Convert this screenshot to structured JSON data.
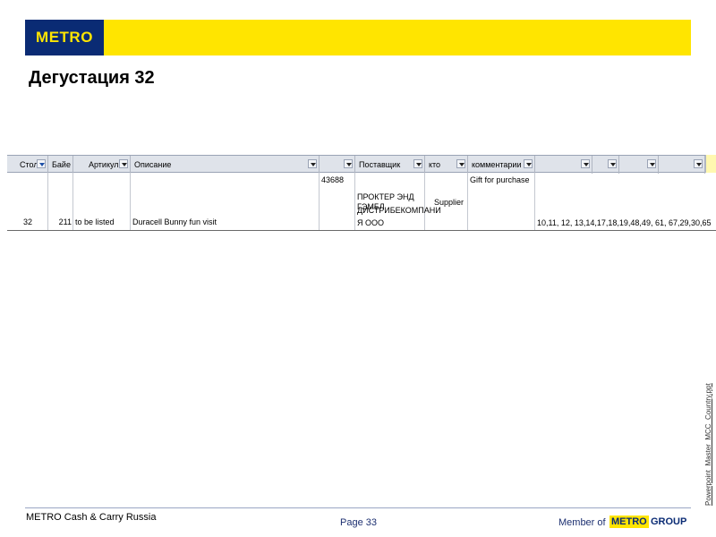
{
  "header": {
    "logo_text": "METRO",
    "brand_colors": {
      "yellow": "#ffe500",
      "navy": "#0a2b74"
    }
  },
  "page_title": "Дегустация 32",
  "table": {
    "columns": [
      {
        "label": "Стол",
        "dropdown": "filtered"
      },
      {
        "label": "Байе",
        "dropdown": "normal"
      },
      {
        "label": "Артикул",
        "dropdown": "normal"
      },
      {
        "label": "Описание",
        "dropdown": "normal"
      },
      {
        "label": "",
        "dropdown": "normal"
      },
      {
        "label": "Поставщик",
        "dropdown": "normal"
      },
      {
        "label": "кто",
        "dropdown": "normal"
      },
      {
        "label": "комментарии",
        "dropdown": "normal"
      },
      {
        "label": "",
        "dropdown": "normal"
      },
      {
        "label": "",
        "dropdown": "normal"
      },
      {
        "label": "",
        "dropdown": "normal"
      },
      {
        "label": "",
        "dropdown": "normal"
      }
    ],
    "row": {
      "table_no": "32",
      "buyer": "211",
      "article": "to be listed",
      "description": "Duracell Bunny fun visit",
      "supplier_code": "43688",
      "supplier_name_lines": [
        "ПРОКТЕР ЭНД ГЭМБЛ",
        "ДИСТРИБЕКОМПАНИ",
        "Я ООО"
      ],
      "who": "Supplier",
      "comment": "Gift for purchase",
      "tables_list": "10,11, 12, 13,14,17,18,19,48,49, 61, 67,29,30,65"
    }
  },
  "side_note": "Powerpoint_Master_MCC_Country.ppt",
  "footer": {
    "company": "METRO Cash & Carry Russia",
    "page_label": "Page 33",
    "member_prefix": "Member of",
    "metro_group_logo": {
      "metro": "METRO",
      "group": "GROUP"
    }
  }
}
